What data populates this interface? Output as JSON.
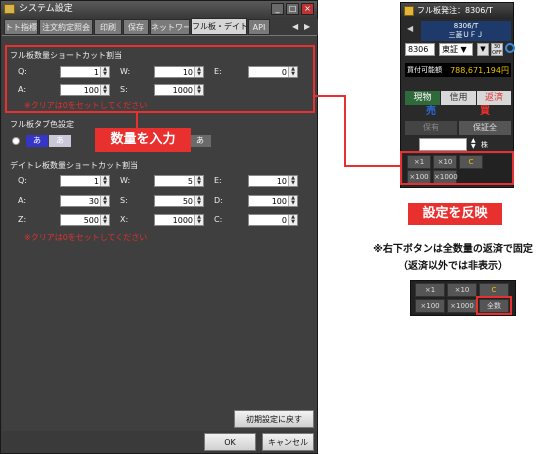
{
  "settings_window": {
    "title": "システム設定",
    "tabs": [
      "トト指標",
      "注文約定照会",
      "印刷",
      "保存",
      "ネットワーク",
      "フル板・デイトレ板",
      "API"
    ],
    "active_tab_index": 5,
    "fullboard_group": {
      "title": "フル板数量ショートカット割当",
      "fields": [
        {
          "label": "Q:",
          "value": "1"
        },
        {
          "label": "W:",
          "value": "10"
        },
        {
          "label": "E:",
          "value": "0"
        },
        {
          "label": "A:",
          "value": "100"
        },
        {
          "label": "S:",
          "value": "1000"
        }
      ],
      "note": "※クリアは0をセットしてください"
    },
    "color_group": {
      "title": "フル板タブ色設定",
      "swatches": [
        "あ",
        "あ",
        "あ"
      ],
      "swatch_colors": [
        "#3535c8",
        "#c8c8d8",
        "#6a6a6a"
      ]
    },
    "daytrade_group": {
      "title": "デイトレ板数量ショートカット割当",
      "fields": [
        {
          "label": "Q:",
          "value": "1"
        },
        {
          "label": "W:",
          "value": "5"
        },
        {
          "label": "E:",
          "value": "10"
        },
        {
          "label": "A:",
          "value": "30"
        },
        {
          "label": "S:",
          "value": "50"
        },
        {
          "label": "D:",
          "value": "100"
        },
        {
          "label": "Z:",
          "value": "500"
        },
        {
          "label": "X:",
          "value": "1000"
        },
        {
          "label": "C:",
          "value": "0"
        }
      ],
      "note": "※クリアは0をセットしてください"
    },
    "reset_button": "初期設定に戻す",
    "ok_button": "OK",
    "cancel_button": "キャンセル"
  },
  "annotations": {
    "input_callout": "数量を入力",
    "reflect_callout": "設定を反映",
    "note_line1": "※右下ボタンは全数量の返済で固定",
    "note_line2": "（返済以外では非表示）"
  },
  "order_panel": {
    "title": "フル板発注：8306/T",
    "stock_code_line": "8306/T",
    "stock_name": "三菱ＵＦＪ",
    "code_input": "8306",
    "market_select": "東証",
    "money_label": "買付可能額",
    "money_value": "788,671,194円",
    "trade_tabs": [
      "現物",
      "信用",
      "返済"
    ],
    "sell_label": "売",
    "buy_label": "買",
    "hoyu_label": "保有",
    "margin_all_label": "保証全",
    "qty_unit": "株",
    "qty_buttons": [
      "×1",
      "×10",
      "C",
      "×100",
      "×1000"
    ],
    "colors": {
      "sell": "#2a6ad8",
      "buy": "#e83030",
      "accent": "#f0c000"
    }
  },
  "example_buttons": {
    "labels": [
      "×1",
      "×10",
      "C",
      "×100",
      "×1000",
      "全数"
    ]
  }
}
